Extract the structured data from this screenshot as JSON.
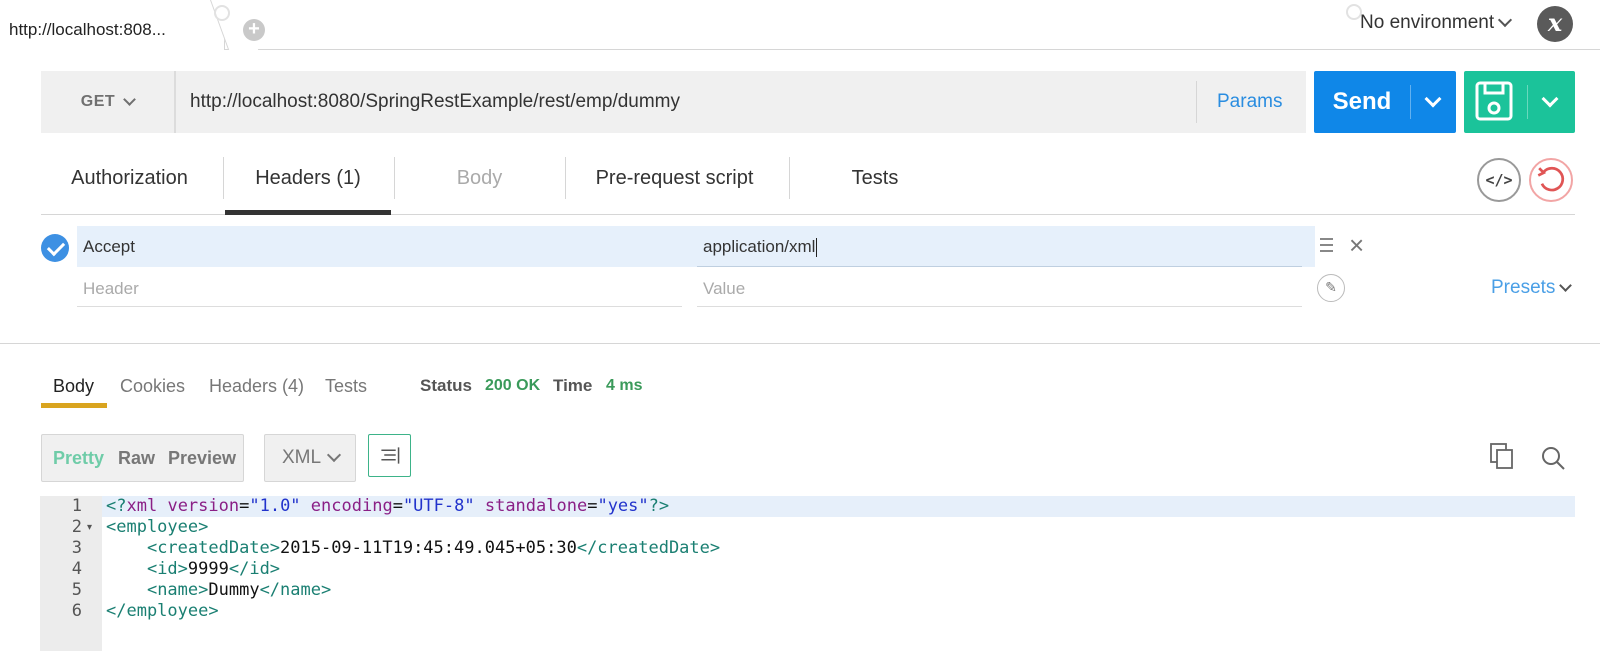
{
  "tab": {
    "label": "http://localhost:808..."
  },
  "environment": {
    "label": "No environment",
    "quicklook_glyph": "x"
  },
  "request": {
    "method": "GET",
    "url": "http://localhost:8080/SpringRestExample/rest/emp/dummy",
    "params_label": "Params",
    "send_label": "Send"
  },
  "request_tabs": [
    {
      "label": "Authorization"
    },
    {
      "label": "Headers (1)"
    },
    {
      "label": "Body"
    },
    {
      "label": "Pre-request script"
    },
    {
      "label": "Tests"
    }
  ],
  "code_button_glyph": "</>",
  "headers": {
    "rows": [
      {
        "key": "Accept",
        "value": "application/xml"
      }
    ],
    "key_placeholder": "Header",
    "value_placeholder": "Value",
    "presets_label": "Presets"
  },
  "response": {
    "tabs": [
      {
        "label": "Body"
      },
      {
        "label": "Cookies"
      },
      {
        "label": "Headers (4)"
      },
      {
        "label": "Tests"
      }
    ],
    "status_label": "Status",
    "status_value": "200 OK",
    "time_label": "Time",
    "time_value": "4 ms",
    "format_buttons": [
      {
        "label": "Pretty"
      },
      {
        "label": "Raw"
      },
      {
        "label": "Preview"
      }
    ],
    "language": "XML",
    "code_lines": [
      {
        "num": "1",
        "parts": [
          [
            "pi",
            "<?"
          ],
          [
            "attr",
            "xml"
          ],
          [
            "plain",
            " "
          ],
          [
            "attr",
            "version"
          ],
          [
            "plain",
            "="
          ],
          [
            "str",
            "\"1.0\""
          ],
          [
            "plain",
            " "
          ],
          [
            "attr",
            "encoding"
          ],
          [
            "plain",
            "="
          ],
          [
            "str",
            "\"UTF-8\""
          ],
          [
            "plain",
            " "
          ],
          [
            "attr",
            "standalone"
          ],
          [
            "plain",
            "="
          ],
          [
            "str",
            "\"yes\""
          ],
          [
            "pi",
            "?>"
          ]
        ]
      },
      {
        "num": "2",
        "parts": [
          [
            "tag",
            "<employee>"
          ]
        ]
      },
      {
        "num": "3",
        "parts": [
          [
            "plain",
            "    "
          ],
          [
            "tag",
            "<createdDate>"
          ],
          [
            "plain",
            "2015-09-11T19:45:49.045+05:30"
          ],
          [
            "tag",
            "</createdDate>"
          ]
        ]
      },
      {
        "num": "4",
        "parts": [
          [
            "plain",
            "    "
          ],
          [
            "tag",
            "<id>"
          ],
          [
            "plain",
            "9999"
          ],
          [
            "tag",
            "</id>"
          ]
        ]
      },
      {
        "num": "5",
        "parts": [
          [
            "plain",
            "    "
          ],
          [
            "tag",
            "<name>"
          ],
          [
            "plain",
            "Dummy"
          ],
          [
            "tag",
            "</name>"
          ]
        ]
      },
      {
        "num": "6",
        "parts": [
          [
            "tag",
            "</employee>"
          ]
        ]
      }
    ]
  },
  "colors": {
    "send": "#0f87e8",
    "save": "#1bc39a",
    "status_ok": "#3a9a5a",
    "active_response_tab": "#d9a41f",
    "link": "#2a8de0"
  }
}
